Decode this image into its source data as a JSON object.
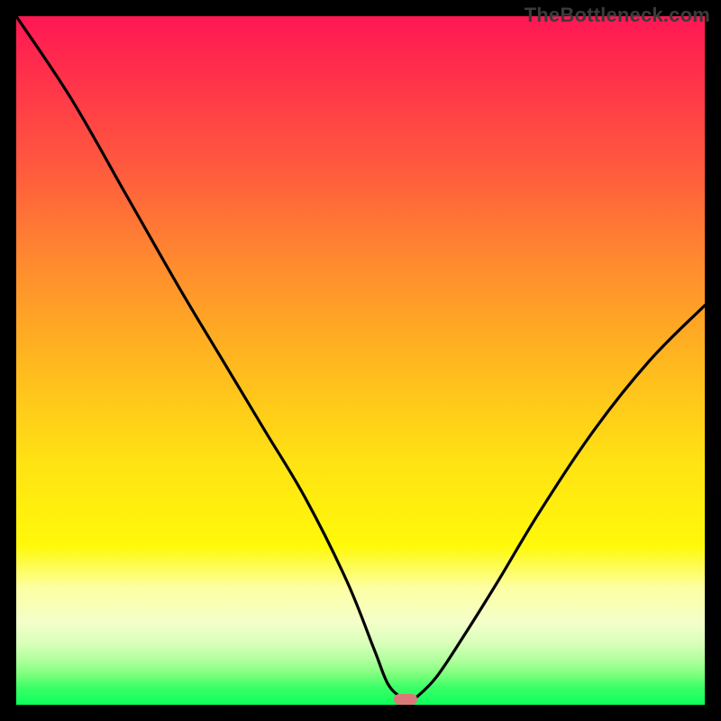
{
  "watermark": "TheBottleneck.com",
  "chart_data": {
    "type": "line",
    "title": "",
    "xlabel": "",
    "ylabel": "",
    "xlim": [
      0,
      100
    ],
    "ylim": [
      0,
      100
    ],
    "grid": false,
    "series": [
      {
        "name": "bottleneck-curve",
        "x": [
          0,
          8,
          16,
          24,
          30,
          36,
          42,
          48,
          52,
          54,
          56,
          57,
          58,
          61,
          65,
          70,
          76,
          84,
          92,
          100
        ],
        "values": [
          100,
          88,
          74,
          60,
          50,
          40,
          30,
          18,
          8,
          3,
          1,
          0.5,
          1,
          4,
          10,
          18,
          28,
          40,
          50,
          58
        ]
      }
    ],
    "marker": {
      "x": 56.5,
      "y": 0.8
    },
    "gradient_stops": [
      {
        "pos": 0,
        "color": "#ff1754"
      },
      {
        "pos": 8,
        "color": "#ff2f4b"
      },
      {
        "pos": 22,
        "color": "#ff5a3e"
      },
      {
        "pos": 36,
        "color": "#ff8b2f"
      },
      {
        "pos": 50,
        "color": "#ffb71f"
      },
      {
        "pos": 65,
        "color": "#ffe313"
      },
      {
        "pos": 77,
        "color": "#fff90a"
      },
      {
        "pos": 83,
        "color": "#fdffa3"
      },
      {
        "pos": 88,
        "color": "#f4ffc9"
      },
      {
        "pos": 91,
        "color": "#d9ffba"
      },
      {
        "pos": 93.5,
        "color": "#b0ff9e"
      },
      {
        "pos": 95.5,
        "color": "#7fff7e"
      },
      {
        "pos": 97.5,
        "color": "#3bff67"
      },
      {
        "pos": 100,
        "color": "#0cff5c"
      }
    ],
    "colors": {
      "curve": "#000000",
      "marker": "#d97a78",
      "frame": "#000000"
    }
  }
}
